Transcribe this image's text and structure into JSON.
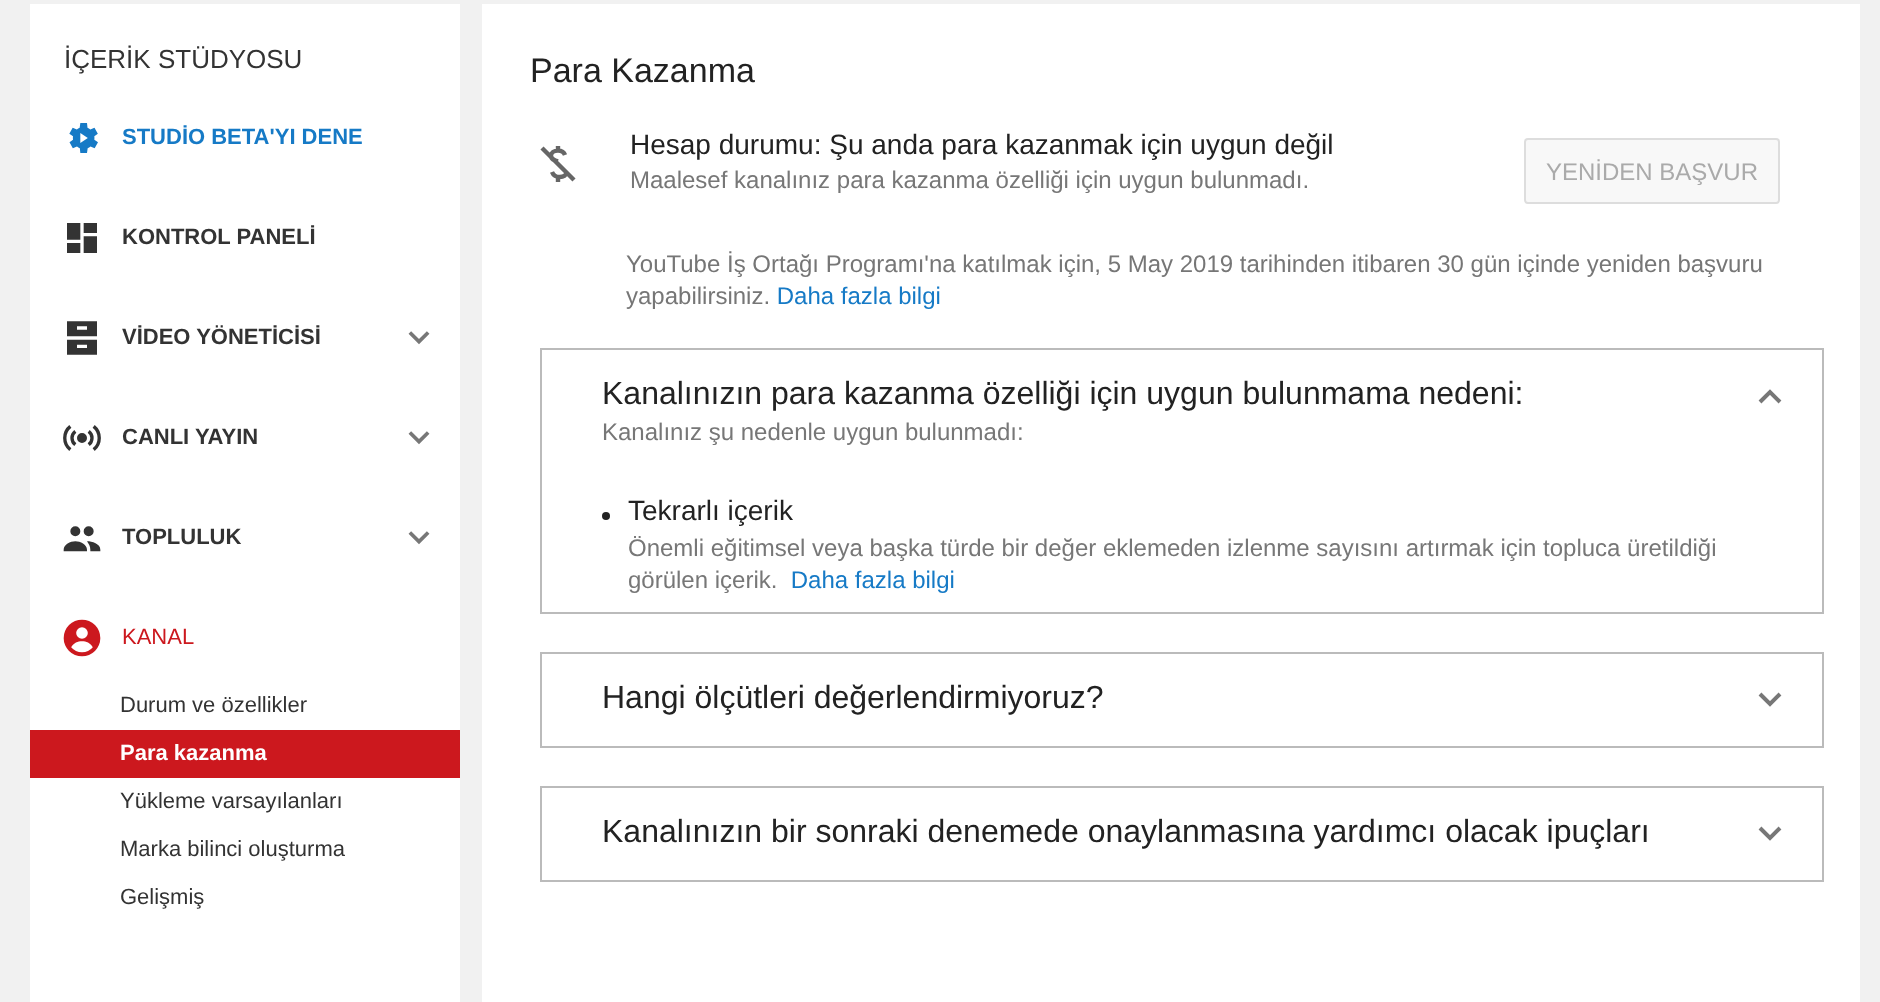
{
  "sidebar": {
    "title": "İÇERİK STÜDYOSU",
    "items": [
      {
        "label": "STUDİO BETA'YI DENE",
        "kind": "beta"
      },
      {
        "label": "KONTROL PANELİ",
        "kind": "link"
      },
      {
        "label": "VİDEO YÖNETİCİSİ",
        "kind": "menu"
      },
      {
        "label": "CANLI YAYIN",
        "kind": "menu"
      },
      {
        "label": "TOPLULUK",
        "kind": "menu"
      },
      {
        "label": "KANAL",
        "kind": "current",
        "children": [
          {
            "label": "Durum ve özellikler",
            "selected": false
          },
          {
            "label": "Para kazanma",
            "selected": true
          },
          {
            "label": "Yükleme varsayılanları",
            "selected": false
          },
          {
            "label": "Marka bilinci oluşturma",
            "selected": false
          },
          {
            "label": "Gelişmiş",
            "selected": false
          }
        ]
      }
    ]
  },
  "main": {
    "title": "Para Kazanma",
    "status": {
      "heading": "Hesap durumu: Şu anda para kazanmak için uygun değil",
      "detail": "Maalesef kanalınız para kazanma özelliği için uygun bulunmadı.",
      "button": {
        "label": "YENİDEN BAŞVUR",
        "disabled": true
      },
      "note": "YouTube İş Ortağı Programı'na katılmak için, 5 May 2019 tarihinden itibaren 30 gün içinde yeniden başvuru yapabilirsiniz.",
      "note_link": "Daha fazla bilgi"
    },
    "sections": [
      {
        "title": "Kanalınızın para kazanma özelliği için uygun bulunmama nedeni:",
        "expanded": true,
        "subtitle": "Kanalınız şu nedenle uygun bulunmadı:",
        "reasons": [
          {
            "title": "Tekrarlı içerik",
            "text": "Önemli eğitimsel veya başka türde bir değer eklemeden izlenme sayısını artırmak için topluca üretildiği görülen içerik.",
            "link": "Daha fazla bilgi"
          }
        ]
      },
      {
        "title": "Hangi ölçütleri değerlendirmiyoruz?",
        "expanded": false
      },
      {
        "title": "Kanalınızın bir sonraki denemede onaylanmasına yardımcı olacak ipuçları",
        "expanded": false
      }
    ]
  }
}
